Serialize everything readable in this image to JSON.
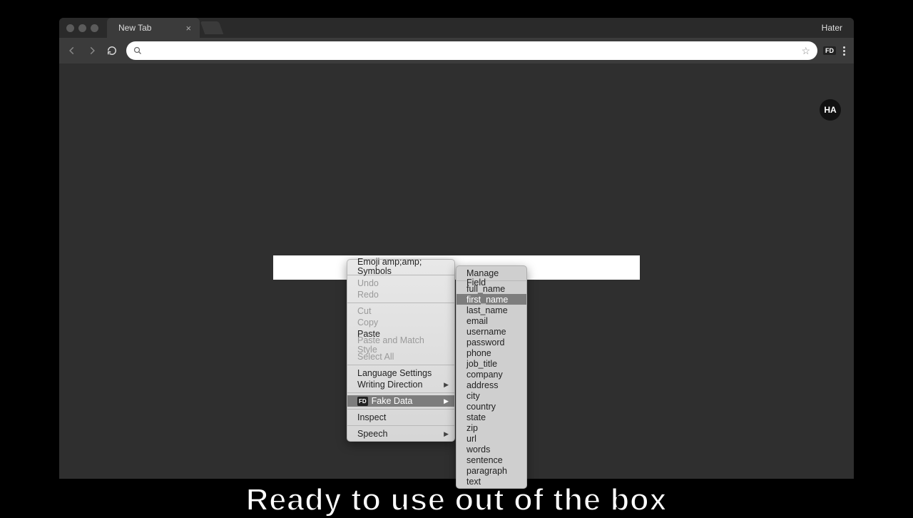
{
  "tabbar": {
    "tab_title": "New Tab",
    "profile": "Hater"
  },
  "toolbar": {
    "extension_badge": "FD"
  },
  "avatar": "HA",
  "context_menu": {
    "items": [
      {
        "label": "Emoji amp;amp; Symbols",
        "enabled": true
      },
      {
        "sep": true
      },
      {
        "label": "Undo",
        "enabled": false
      },
      {
        "label": "Redo",
        "enabled": false
      },
      {
        "sep": true
      },
      {
        "label": "Cut",
        "enabled": false
      },
      {
        "label": "Copy",
        "enabled": false
      },
      {
        "label": "Paste",
        "enabled": true
      },
      {
        "label": "Paste and Match Style",
        "enabled": false
      },
      {
        "label": "Select All",
        "enabled": false
      },
      {
        "sep": true
      },
      {
        "label": "Language Settings",
        "enabled": true
      },
      {
        "label": "Writing Direction",
        "enabled": true,
        "submenu": true
      },
      {
        "sep": true
      },
      {
        "label": "Fake Data",
        "enabled": true,
        "submenu": true,
        "highlight": true,
        "badge": "FD"
      },
      {
        "sep": true
      },
      {
        "label": "Inspect",
        "enabled": true
      },
      {
        "sep": true
      },
      {
        "label": "Speech",
        "enabled": true,
        "submenu": true
      }
    ]
  },
  "submenu": {
    "header": "Manage Field",
    "items": [
      "full_name",
      "first_name",
      "last_name",
      "email",
      "username",
      "password",
      "phone",
      "job_title",
      "company",
      "address",
      "city",
      "country",
      "state",
      "zip",
      "url",
      "words",
      "sentence",
      "paragraph",
      "text"
    ],
    "highlight_index": 1
  },
  "caption": "Ready to use out of the box"
}
